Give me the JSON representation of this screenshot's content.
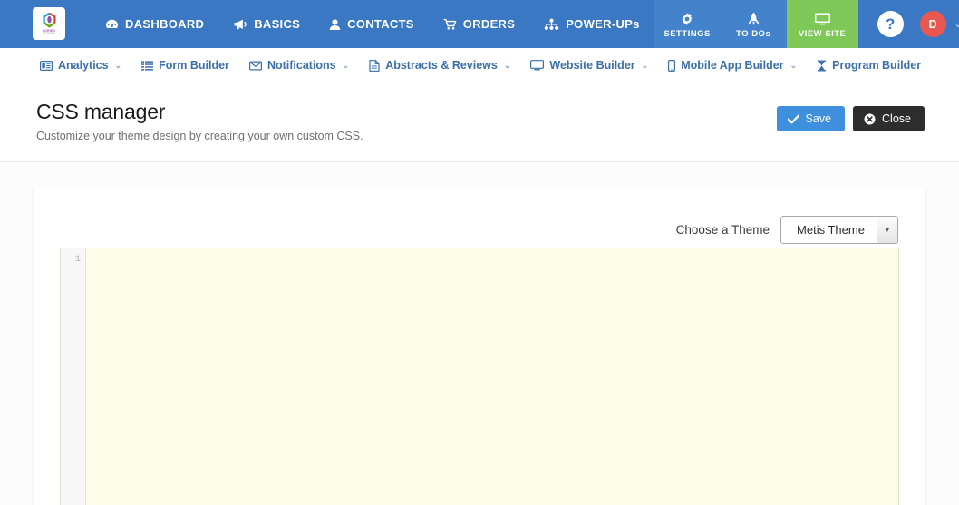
{
  "brand": {
    "name": "LORIEN",
    "tagline": "CO Solution",
    "icon": "brand-logo-icon"
  },
  "topnav": {
    "items": [
      {
        "label": "DASHBOARD",
        "icon": "dashboard-icon"
      },
      {
        "label": "BASICS",
        "icon": "megaphone-icon"
      },
      {
        "label": "CONTACTS",
        "icon": "user-icon"
      },
      {
        "label": "ORDERS",
        "icon": "cart-icon"
      },
      {
        "label": "POWER-UPs",
        "icon": "sitemap-icon"
      }
    ],
    "right_blocks": [
      {
        "label": "SETTINGS",
        "icon": "gear-icon"
      },
      {
        "label": "TO DOs",
        "icon": "rocket-icon"
      },
      {
        "label": "VIEW SITE",
        "icon": "monitor-icon"
      }
    ],
    "help_label": "?",
    "avatar_initial": "D",
    "user_caret": "⌄",
    "colors": {
      "navbar_blue": "#3b78c3",
      "view_site_green": "#7ec857",
      "avatar_red": "#e8584f"
    }
  },
  "subnav": {
    "items": [
      {
        "label": "Analytics",
        "icon": "analytics-icon",
        "caret": true
      },
      {
        "label": "Form Builder",
        "icon": "list-icon",
        "caret": false
      },
      {
        "label": "Notifications",
        "icon": "envelope-icon",
        "caret": true
      },
      {
        "label": "Abstracts & Reviews",
        "icon": "document-icon",
        "caret": true
      },
      {
        "label": "Website Builder",
        "icon": "monitor-icon",
        "caret": true
      },
      {
        "label": "Mobile App Builder",
        "icon": "mobile-icon",
        "caret": true
      },
      {
        "label": "Program Builder",
        "icon": "hourglass-icon",
        "caret": false
      }
    ],
    "caret_glyph": "⌄"
  },
  "page": {
    "title": "CSS manager",
    "subtitle": "Customize your theme design by creating your own custom CSS.",
    "save_label": "Save",
    "close_label": "Close",
    "save_icon": "check-icon",
    "close_icon": "close-circle-icon"
  },
  "editor_panel": {
    "theme_label": "Choose a Theme",
    "theme_selected": "Metis Theme",
    "theme_options": [
      "Metis Theme"
    ],
    "select_caret": "▾",
    "line_numbers": [
      "1"
    ],
    "code_value": "",
    "code_placeholder": ""
  }
}
